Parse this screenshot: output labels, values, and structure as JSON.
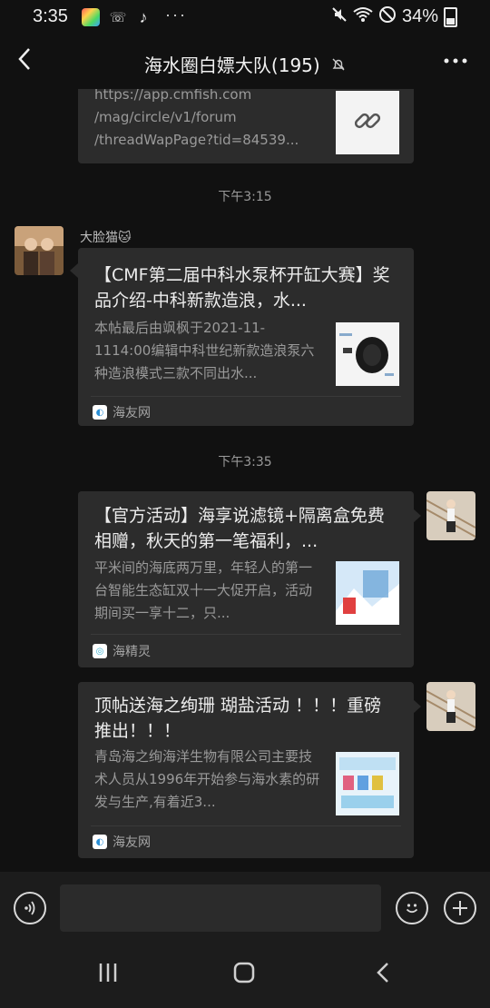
{
  "status_bar": {
    "time": "3:35",
    "battery": "34%",
    "more": "···"
  },
  "header": {
    "title": "海水圈白嫖大队(195)"
  },
  "messages": {
    "prev_link_lines": [
      "https://app.cmfish.com",
      "/mag/circle/v1/forum",
      "/threadWapPage?tid=84539..."
    ],
    "time1": "下午3:15",
    "msg1": {
      "sender": "大脸猫🐱",
      "headline": "【CMF第二届中科水泵杯开缸大赛】奖品介绍-中科新款造浪，水...",
      "desc": "本帖最后由飒枫于2021-11-1114:00编辑中科世纪新款造浪泵六种造浪模式三款不同出水...",
      "source": "海友网"
    },
    "time2": "下午3:35",
    "msg2": {
      "headline": "【官方活动】海享说滤镜+隔离盒免费相赠，秋天的第一笔福利，...",
      "desc": "平米间的海底两万里，年轻人的第一台智能生态缸双十一大促开启，活动期间买一享十二，只...",
      "source": "海精灵"
    },
    "msg3": {
      "headline": "顶帖送海之绚珊 瑚盐活动 ！！！重磅推出！！！",
      "desc": "青岛海之绚海洋生物有限公司主要技术人员从1996年开始参与海水素的研发与生产,有着近3...",
      "source": "海友网"
    }
  },
  "input": {
    "placeholder": ""
  },
  "colors": {
    "background": "#111111",
    "bubble": "#2c2c2c",
    "text_primary": "#ececec",
    "text_secondary": "#9a9a9a"
  }
}
